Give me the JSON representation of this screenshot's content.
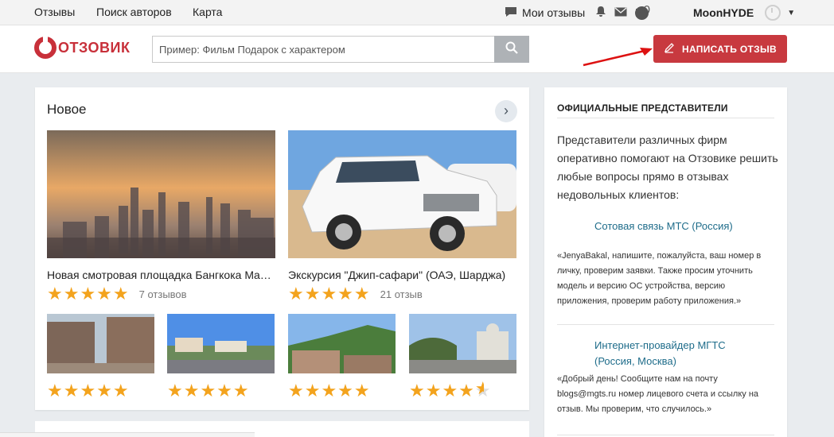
{
  "topnav": {
    "links": [
      "Отзывы",
      "Поиск авторов",
      "Карта"
    ],
    "my_reviews": "Мои отзывы",
    "points_icon_text": "P",
    "points_count": "0",
    "username": "MoonHYDE",
    "icons": [
      "chat-icon",
      "bell-icon",
      "envelope-icon",
      "points-icon",
      "avatar-icon",
      "caret-down-icon"
    ]
  },
  "header": {
    "logo_text": "ОТЗОВИК",
    "search_placeholder": "Пример: Фильм Подарок с характером",
    "write_button": "НАПИСАТЬ ОТЗЫВ"
  },
  "new_section": {
    "title": "Новое",
    "featured": [
      {
        "title": "Новая смотровая площадка Бангкока Maha...",
        "stars": 5,
        "reviews": "7 отзывов"
      },
      {
        "title": "Экскурсия \"Джип-сафари\" (ОАЭ, Шарджа)",
        "stars": 5,
        "reviews": "21 отзыв"
      }
    ],
    "thumbs": [
      {
        "stars": 5
      },
      {
        "stars": 5
      },
      {
        "stars": 5
      },
      {
        "stars": 4.5
      }
    ]
  },
  "representatives": {
    "title": "ОФИЦИАЛЬНЫЕ ПРЕДСТАВИТЕЛИ",
    "intro": "Представители различных фирм оперативно помогают на Отзовике решить любые вопросы прямо в отзывах недовольных клиентов:",
    "items": [
      {
        "company": "Сотовая связь МТС (Россия)",
        "quote": "«JenyaBakal, напишите, пожалуйста, ваш номер в личку, проверим заявки. Также просим уточнить модель и версию ОС устройства, версию приложения, проверим работу приложения.»"
      },
      {
        "company": "Интернет-провайдер МГТС (Россия, Москва)",
        "quote": "«Добрый день! Сообщите нам на почту blogs@mgts.ru номер лицевого счета и ссылку на отзыв. Мы проверим, что случилось.»"
      }
    ]
  },
  "colors": {
    "accent": "#c8393f",
    "star": "#f3a31d",
    "link": "#1e6c8a",
    "bg": "#e9ecef"
  }
}
